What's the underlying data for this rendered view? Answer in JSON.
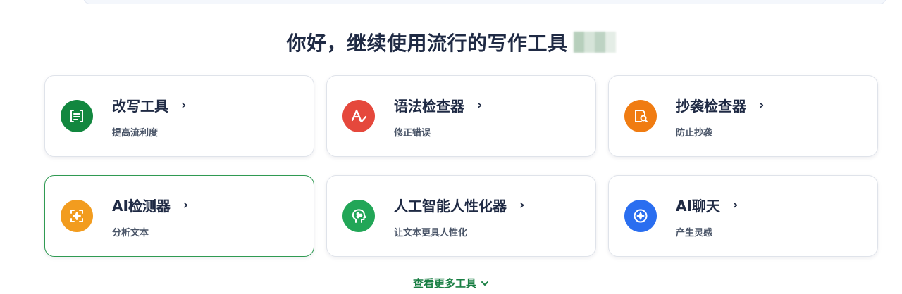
{
  "greeting": {
    "text": "你好，继续使用流行的写作工具"
  },
  "tools": [
    {
      "title": "改写工具",
      "subtitle": "提高流利度",
      "icon": "paraphrase-icon",
      "color": "#12873f"
    },
    {
      "title": "语法检查器",
      "subtitle": "修正错误",
      "icon": "grammar-check-icon",
      "color": "#e5483c"
    },
    {
      "title": "抄袭检查器",
      "subtitle": "防止抄袭",
      "icon": "plagiarism-search-icon",
      "color": "#f07c12"
    },
    {
      "title": "AI检测器",
      "subtitle": "分析文本",
      "icon": "ai-detector-icon",
      "color": "#f29c1f"
    },
    {
      "title": "人工智能人性化器",
      "subtitle": "让文本更具人性化",
      "icon": "humanizer-head-icon",
      "color": "#22a657"
    },
    {
      "title": "AI聊天",
      "subtitle": "产生灵感",
      "icon": "ai-chat-sparkle-icon",
      "color": "#2a6ef0"
    }
  ],
  "more": {
    "label": "查看更多工具"
  }
}
